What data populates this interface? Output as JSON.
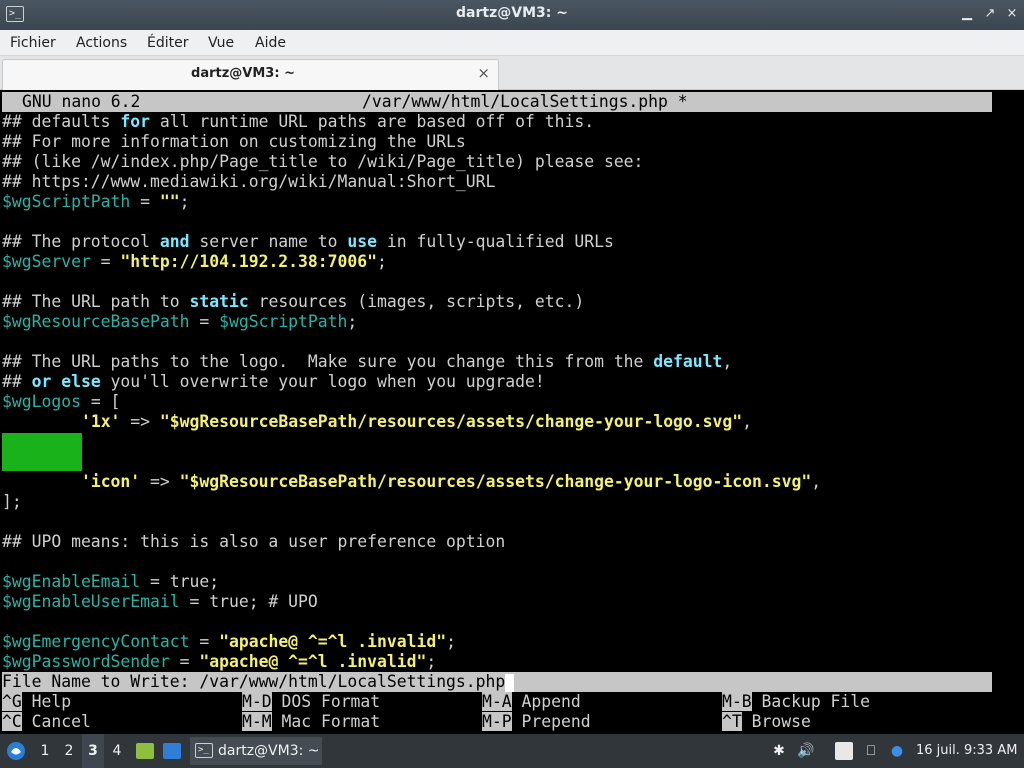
{
  "window": {
    "title": "dartz@VM3: ~",
    "menu": [
      "Fichier",
      "Actions",
      "Éditer",
      "Vue",
      "Aide"
    ],
    "tab_title": "dartz@VM3: ~",
    "close_symbol": "×",
    "term_icon_glyph": ">_"
  },
  "nano": {
    "version_label": "GNU nano 6.2",
    "file_title": "/var/www/html/LocalSettings.php *",
    "lines": [
      [
        [
          "c",
          "## defaults "
        ],
        [
          "k",
          "for"
        ],
        [
          "c",
          " all runtime URL paths are based off of this."
        ]
      ],
      [
        [
          "c",
          "## For more information on customizing the URLs"
        ]
      ],
      [
        [
          "c",
          "## (like /w/index.php/Page_title to /wiki/Page_title) please see:"
        ]
      ],
      [
        [
          "c",
          "## https://www.mediawiki.org/wiki/Manual:Short_URL"
        ]
      ],
      [
        [
          "v",
          "$wgScriptPath"
        ],
        [
          "c",
          " = "
        ],
        [
          "s",
          "\"\""
        ],
        [
          "c",
          ";"
        ]
      ],
      [],
      [
        [
          "c",
          "## The protocol "
        ],
        [
          "k",
          "and"
        ],
        [
          "c",
          " server name to "
        ],
        [
          "k",
          "use"
        ],
        [
          "c",
          " in fully-qualified URLs"
        ]
      ],
      [
        [
          "v",
          "$wgServer"
        ],
        [
          "c",
          " = "
        ],
        [
          "s",
          "\"http://104.192.2.38:7006\""
        ],
        [
          "c",
          ";"
        ]
      ],
      [],
      [
        [
          "c",
          "## The URL path to "
        ],
        [
          "k",
          "static"
        ],
        [
          "c",
          " resources (images, scripts, etc.)"
        ]
      ],
      [
        [
          "v",
          "$wgResourceBasePath"
        ],
        [
          "c",
          " = "
        ],
        [
          "v",
          "$wgScriptPath"
        ],
        [
          "c",
          ";"
        ]
      ],
      [],
      [
        [
          "c",
          "## The URL paths to the logo.  Make sure you change this from the "
        ],
        [
          "k",
          "default"
        ],
        [
          "c",
          ","
        ]
      ],
      [
        [
          "c",
          "## "
        ],
        [
          "k",
          "or else"
        ],
        [
          "c",
          " you'll overwrite your logo when you upgrade!"
        ]
      ],
      [
        [
          "v",
          "$wgLogos"
        ],
        [
          "c",
          " = ["
        ]
      ],
      [
        [
          "c",
          "        "
        ],
        [
          "s",
          "'1x'"
        ],
        [
          "c",
          " => "
        ],
        [
          "s",
          "\"$wgResourceBasePath/resources/assets/change-your-logo.svg\""
        ],
        [
          "c",
          ","
        ]
      ],
      [],
      [],
      [
        [
          "c",
          "        "
        ],
        [
          "s",
          "'icon'"
        ],
        [
          "c",
          " => "
        ],
        [
          "s",
          "\"$wgResourceBasePath/resources/assets/change-your-logo-icon.svg\""
        ],
        [
          "c",
          ","
        ]
      ],
      [
        [
          "c",
          "];"
        ]
      ],
      [],
      [
        [
          "c",
          "## UPO means: this is also a user preference option"
        ]
      ],
      [],
      [
        [
          "v",
          "$wgEnableEmail"
        ],
        [
          "c",
          " = true;"
        ]
      ],
      [
        [
          "v",
          "$wgEnableUserEmail"
        ],
        [
          "c",
          " = true; # UPO"
        ]
      ],
      [],
      [
        [
          "v",
          "$wgEmergencyContact"
        ],
        [
          "c",
          " = "
        ],
        [
          "s",
          "\"apache@ ^=^l .invalid\""
        ],
        [
          "c",
          ";"
        ]
      ],
      [
        [
          "v",
          "$wgPasswordSender"
        ],
        [
          "c",
          " = "
        ],
        [
          "s",
          "\"apache@ ^=^l .invalid\""
        ],
        [
          "c",
          ";"
        ]
      ]
    ],
    "prompt": "File Name to Write: /var/www/html/LocalSettings.php",
    "shortcuts_row1": [
      {
        "key": "^G",
        "label": "Help"
      },
      {
        "key": "M-D",
        "label": "DOS Format"
      },
      {
        "key": "M-A",
        "label": "Append"
      },
      {
        "key": "M-B",
        "label": "Backup File"
      }
    ],
    "shortcuts_row2": [
      {
        "key": "^C",
        "label": "Cancel"
      },
      {
        "key": "M-M",
        "label": "Mac Format"
      },
      {
        "key": "M-P",
        "label": "Prepend"
      },
      {
        "key": "^T",
        "label": "Browse"
      }
    ]
  },
  "taskbar": {
    "desktops": [
      "1",
      "2",
      "3",
      "4"
    ],
    "active_desktop": "3",
    "task_label": "dartz@VM3: ~",
    "clock": "16 juil. 9:33 AM"
  },
  "colors": {
    "comment": "#d0d0d0",
    "variable": "#29b3a6",
    "keyword": "#7ce8ff",
    "string": "#f4f070",
    "selection_block": "#1ab21a",
    "status_bar": "#c6c6c6"
  }
}
